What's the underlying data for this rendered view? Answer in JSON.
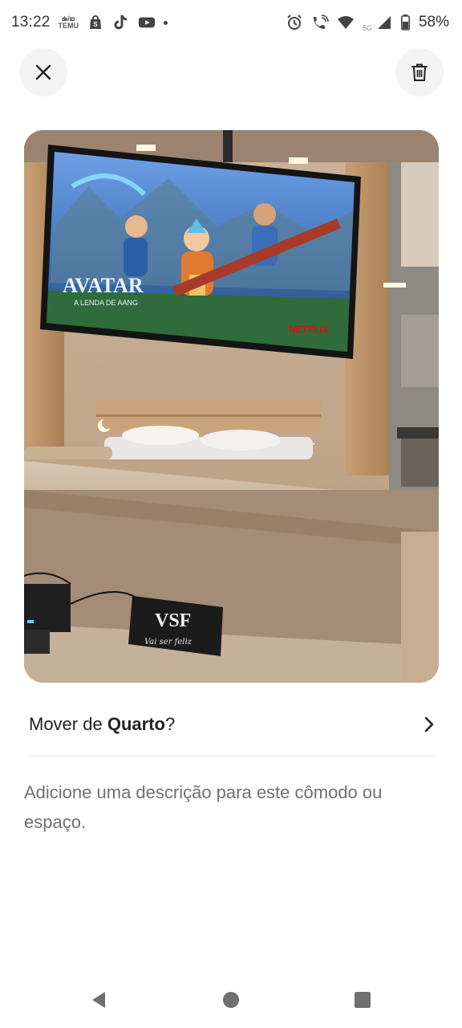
{
  "status_bar": {
    "time": "13:22",
    "mini_label_top": "ఉ/ఐ",
    "mini_label_bottom": "TEMU",
    "network_label": "5G",
    "battery": "58%"
  },
  "header": {
    "close_icon": "close-icon",
    "delete_icon": "trash-icon"
  },
  "photo": {
    "alt": "Quarto",
    "tv_title": "AVATAR",
    "tv_subtitle": "A LENDA DE AANG",
    "tv_brand": "NETFLIX",
    "sign_text": "VSF",
    "sign_script": "Vai ser feliz"
  },
  "move": {
    "prefix": "Mover de ",
    "room": "Quarto",
    "suffix": "?"
  },
  "description_placeholder": "Adicione uma descrição para este cômodo ou espaço.",
  "colors": {
    "accent": "#222222",
    "muted": "#707070",
    "divider": "#e2e2e2",
    "button_bg": "#f4f4f4"
  }
}
